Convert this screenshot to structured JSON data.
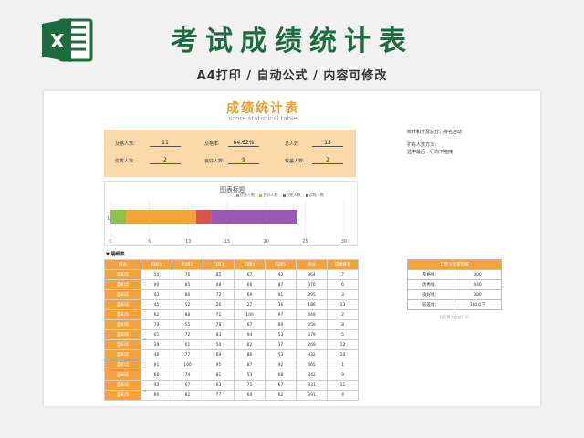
{
  "banner": {
    "title": "考试成绩统计表",
    "subtitle": "A4打印 / 自动公式 / 内容可修改",
    "logo_letter": "X",
    "brand_color": "#1e6b40"
  },
  "sheet": {
    "title": "成绩统计表",
    "subtitle": "score statistical table",
    "stats": {
      "fail_label": "及格人数:",
      "fail_value": "11",
      "rate_label": "及格率:",
      "rate_value": "84.62%",
      "total_label": "总人数:",
      "total_value": "13",
      "excellent_label": "优秀人数:",
      "excellent_value": "2",
      "good_label": "良好人数:",
      "good_value": "9",
      "poor_label": "较差人数:",
      "poor_value": "2"
    },
    "notes": [
      "统计和分及总分，排名自动",
      "扩充人数方法：",
      "选中最后一行向下拖拽"
    ],
    "section_label": "▼ 明细表",
    "custom_note": "此设置不会被打印"
  },
  "chart_data": {
    "type": "bar",
    "orientation": "horizontal",
    "stacked": true,
    "title": "图表标题",
    "categories": [
      "1"
    ],
    "series": [
      {
        "name": "优秀人数",
        "values": [
          2
        ],
        "color": "#8bc34a"
      },
      {
        "name": "良好人数",
        "values": [
          9
        ],
        "color": "#f4a23c"
      },
      {
        "name": "较差人数",
        "values": [
          2
        ],
        "color": "#d9534f"
      },
      {
        "name": "及格人数",
        "values": [
          11
        ],
        "color": "#9b59b6"
      }
    ],
    "xlim": [
      0,
      30
    ],
    "xticks": [
      "0",
      "5",
      "10",
      "15",
      "20",
      "25",
      "30"
    ],
    "grid": true,
    "legend": "top-right"
  },
  "detail": {
    "headers": [
      "姓名",
      "科目1",
      "科目2",
      "科目3",
      "科目4",
      "科目5",
      "总分",
      "成绩排名"
    ],
    "rows": [
      [
        "蓝知华",
        "50",
        "70",
        "85",
        "67",
        "92",
        "364",
        "7"
      ],
      [
        "蓝知华",
        "90",
        "85",
        "48",
        "66",
        "87",
        "376",
        "6"
      ],
      [
        "蓝知华",
        "63",
        "80",
        "72",
        "69",
        "91",
        "395",
        "3"
      ],
      [
        "蓝知华",
        "45",
        "52",
        "26",
        "27",
        "36",
        "186",
        "13"
      ],
      [
        "蓝知华",
        "92",
        "88",
        "72",
        "100",
        "97",
        "449",
        "2"
      ],
      [
        "蓝知华",
        "70",
        "55",
        "78",
        "67",
        "89",
        "359",
        "8"
      ],
      [
        "蓝知华",
        "61",
        "72",
        "83",
        "94",
        "53",
        "379",
        "5"
      ],
      [
        "蓝知华",
        "39",
        "61",
        "50",
        "82",
        "37",
        "269",
        "12"
      ],
      [
        "蓝知华",
        "48",
        "77",
        "69",
        "86",
        "53",
        "332",
        "10"
      ],
      [
        "蓝知华",
        "91",
        "100",
        "95",
        "87",
        "92",
        "465",
        "1"
      ],
      [
        "蓝知华",
        "66",
        "74",
        "81",
        "53",
        "68",
        "342",
        "9"
      ],
      [
        "蓝知华",
        "43",
        "67",
        "63",
        "71",
        "67",
        "331",
        "11"
      ],
      [
        "蓝知华",
        "80",
        "82",
        "77",
        "60",
        "92",
        "391",
        "4"
      ]
    ]
  },
  "custom": {
    "header": "自定义设置区域",
    "rows": [
      [
        "及格线：",
        "300"
      ],
      [
        "优秀线：",
        "440"
      ],
      [
        "良好线：",
        "380"
      ],
      [
        "较差线：",
        "300以下"
      ]
    ]
  }
}
